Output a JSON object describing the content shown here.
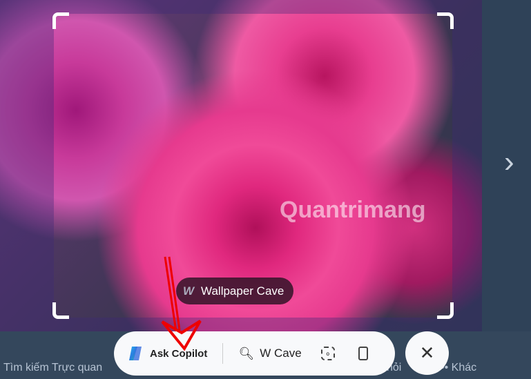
{
  "image": {
    "chip_label": "Wallpaper Cave",
    "chip_logo": "W",
    "watermark": "Quantrimang"
  },
  "toolbar": {
    "ask_copilot": "Ask Copilot",
    "search_label": "W Cave"
  },
  "bottom": {
    "visual_search": "Tìm kiếm Trực quan",
    "ask": "hỏi",
    "more": "Khác"
  }
}
